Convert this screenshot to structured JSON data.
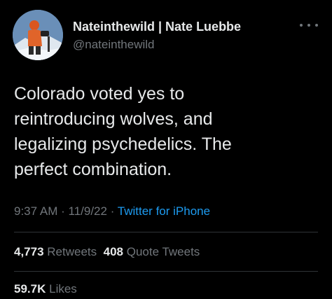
{
  "author": {
    "display_name": "Nateinthewild | Nate Luebbe",
    "handle": "@nateinthewild",
    "avatar_icon": "profile-photo-mountaineer"
  },
  "tweet": {
    "text_lines": [
      "Colorado voted yes to",
      "reintroducing wolves, and",
      "legalizing psychedelics. The",
      "perfect combination."
    ],
    "time": "9:37 AM",
    "date": "11/9/22",
    "separator": "·",
    "source": "Twitter for iPhone"
  },
  "stats": {
    "retweets_count": "4,773",
    "retweets_label": "Retweets",
    "quotes_count": "408",
    "quotes_label": "Quote Tweets",
    "likes_count": "59.7K",
    "likes_label": "Likes"
  },
  "colors": {
    "background": "#000000",
    "text_primary": "#e7e9ea",
    "text_secondary": "#71767b",
    "link": "#1d9bf0",
    "divider": "#2f3336"
  }
}
